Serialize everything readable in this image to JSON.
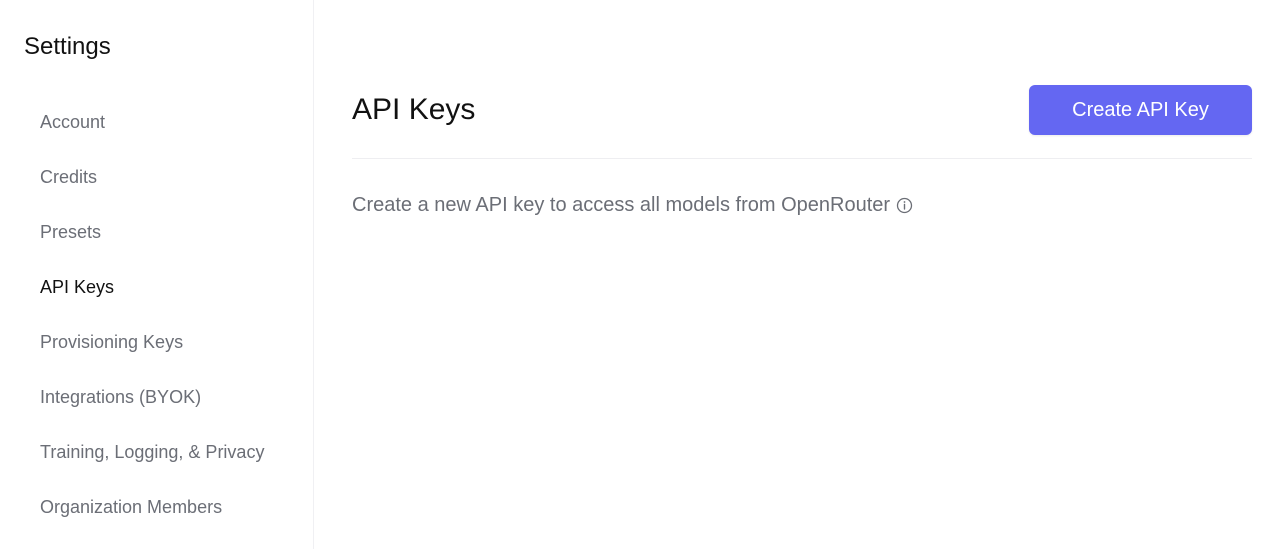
{
  "sidebar": {
    "title": "Settings",
    "items": [
      {
        "label": "Account",
        "active": false
      },
      {
        "label": "Credits",
        "active": false
      },
      {
        "label": "Presets",
        "active": false
      },
      {
        "label": "API Keys",
        "active": true
      },
      {
        "label": "Provisioning Keys",
        "active": false
      },
      {
        "label": "Integrations (BYOK)",
        "active": false
      },
      {
        "label": "Training, Logging, & Privacy",
        "active": false
      },
      {
        "label": "Organization Members",
        "active": false
      }
    ]
  },
  "main": {
    "title": "API Keys",
    "create_button_label": "Create API Key",
    "description": "Create a new API key to access all models from OpenRouter",
    "info_icon": "info-icon"
  },
  "colors": {
    "accent": "#6467f2",
    "muted_text": "#6b6e76",
    "active_text": "#111111",
    "divider": "#eeeef1"
  }
}
